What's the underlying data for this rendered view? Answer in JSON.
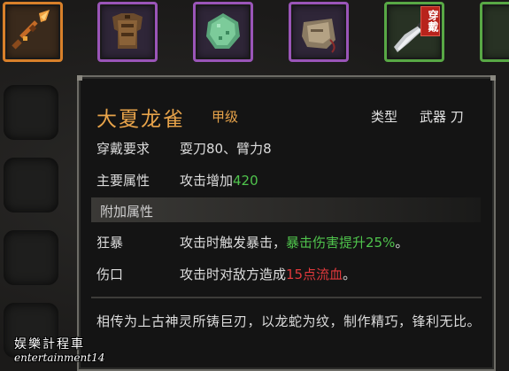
{
  "slots": [
    {
      "icon": "spear-icon",
      "rarity": "orange"
    },
    {
      "icon": "leather-armor-icon",
      "rarity": "purple"
    },
    {
      "icon": "jade-stone-icon",
      "rarity": "purple"
    },
    {
      "icon": "pouch-icon",
      "rarity": "purple"
    },
    {
      "icon": "saber-icon",
      "rarity": "green",
      "badge": "穿戴"
    },
    {
      "icon": "item-icon",
      "rarity": "green"
    }
  ],
  "tooltip": {
    "name": "大夏龙雀",
    "grade": "甲级",
    "type_label": "类型",
    "type_value": "武器 刀",
    "requirement": {
      "label": "穿戴要求",
      "value": "耍刀80、臂力8"
    },
    "main_attr": {
      "label": "主要属性",
      "prefix": "攻击增加 ",
      "value": "420"
    },
    "extra_header": "附加属性",
    "extras": [
      {
        "label": "狂暴",
        "text": "攻击时触发暴击，",
        "highlight": "暴击伤害提升25%",
        "suffix": "。"
      },
      {
        "label": "伤口",
        "text": "攻击时对敌方造成",
        "highlight": "15点流血",
        "suffix": "。"
      }
    ],
    "description": "相传为上古神灵所铸巨刃，以龙蛇为纹，制作精巧，锋利无比。"
  },
  "watermark": {
    "cn": "娱樂計程車",
    "en": "entertainment14"
  },
  "colors": {
    "name": "#e7a34a",
    "positive": "#4fc34c",
    "negative": "#e0393c",
    "rarity_orange": "#d8802a",
    "rarity_purple": "#9a55b8",
    "rarity_green": "#58a845",
    "badge_red": "#b8231c"
  }
}
